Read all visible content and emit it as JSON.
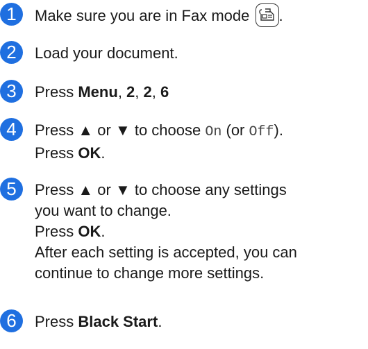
{
  "steps": [
    {
      "number": "1",
      "text_before": "Make sure you are in Fax mode",
      "icon": "fax-mode-icon",
      "text_after": "."
    },
    {
      "number": "2",
      "text": "Load your document."
    },
    {
      "number": "3",
      "press": "Press ",
      "menu": "Menu",
      "sep": ", ",
      "k1": "2",
      "k2": "2",
      "k3": "6"
    },
    {
      "number": "4",
      "line1_a": "Press ",
      "up": "▲",
      "or": " or ",
      "down": "▼",
      "to_choose": " to choose ",
      "on": "On",
      "paren_or": " (or ",
      "off": "Off",
      "paren_close": ").",
      "line2_a": "Press ",
      "ok": "OK",
      "period": "."
    },
    {
      "number": "5",
      "line1_a": "Press ",
      "up": "▲",
      "or": " or ",
      "down": "▼",
      "line1_b": " to choose any settings",
      "line2": "you want to change.",
      "line3_a": "Press ",
      "ok": "OK",
      "period": ".",
      "line4": "After each setting is accepted, you can",
      "line5": "continue to change more settings."
    },
    {
      "number": "6",
      "press": "Press ",
      "black_start": "Black Start",
      "period": "."
    }
  ],
  "colors": {
    "badge": "#1f6fe0",
    "text": "#1a1a1a"
  }
}
